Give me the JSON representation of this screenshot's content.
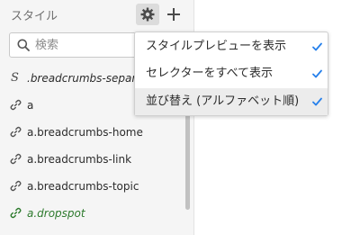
{
  "panel": {
    "title": "スタイル",
    "search": {
      "placeholder": "検索",
      "value": ""
    }
  },
  "styles": [
    {
      "label": ".breadcrumbs-separator",
      "icon": "paragraph-style-icon"
    },
    {
      "label": "a",
      "icon": "link-icon"
    },
    {
      "label": "a.breadcrumbs-home",
      "icon": "link-icon"
    },
    {
      "label": "a.breadcrumbs-link",
      "icon": "link-icon"
    },
    {
      "label": "a.breadcrumbs-topic",
      "icon": "link-icon"
    },
    {
      "label": "a.dropspot",
      "icon": "link-icon",
      "color": "#2d7a2d"
    }
  ],
  "menu": {
    "items": [
      {
        "label": "スタイルプレビューを表示",
        "checked": true
      },
      {
        "label": "セレクターをすべて表示",
        "checked": true
      },
      {
        "label": "並び替え (アルファベット順)",
        "checked": true
      }
    ]
  },
  "colors": {
    "accent": "#2680eb",
    "special_text": "#2d7a2d"
  }
}
